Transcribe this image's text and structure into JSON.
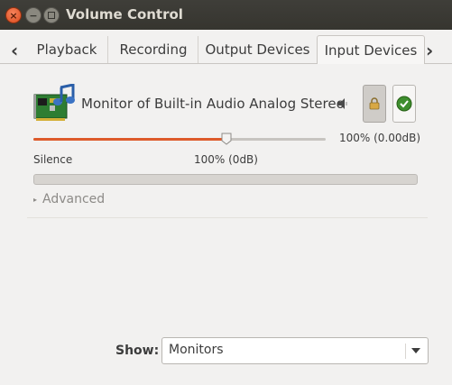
{
  "window": {
    "title": "Volume Control"
  },
  "tabs": [
    {
      "label": "Playback"
    },
    {
      "label": "Recording"
    },
    {
      "label": "Output Devices"
    },
    {
      "label": "Input Devices",
      "active": true
    }
  ],
  "device": {
    "name": "Monitor of Built-in Audio Analog Stereo",
    "icon": "audio-card-icon",
    "volume_readout": "100% (0.00dB)",
    "volume_level": 0.66,
    "silence_label": "Silence",
    "hundred_label": "100% (0dB)",
    "advanced_label": "Advanced"
  },
  "show": {
    "label": "Show:",
    "value": "Monitors"
  },
  "colors": {
    "accent": "#dd5a2a",
    "titlebar": "#3c3b37",
    "close": "#f0643c"
  }
}
